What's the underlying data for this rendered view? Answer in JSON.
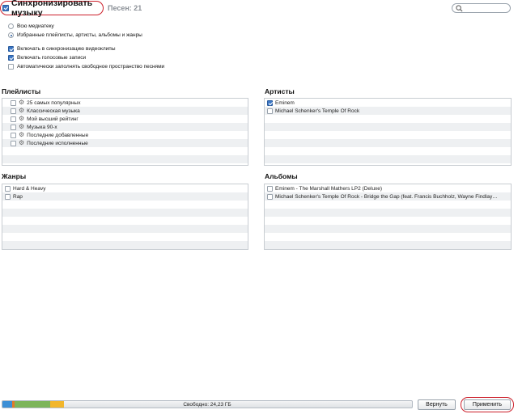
{
  "header": {
    "sync_label": "Синхронизировать музыку",
    "sync_checked": true,
    "song_count": "Песен: 21",
    "search_placeholder": ""
  },
  "options": {
    "radio_all": "Всю медиатеку",
    "radio_selected": "Избранные плейлисты, артисты, альбомы и жанры",
    "include_videos": "Включать в синхронизацию видеоклипы",
    "include_voice": "Включать голосовые записи",
    "autofill": "Автоматически заполнять свободное пространство песнями"
  },
  "playlists": {
    "title": "Плейлисты",
    "items": [
      "25 самых популярных",
      "Классическая музыка",
      "Мой высший рейтинг",
      "Музыка 90-х",
      "Последние добавленные",
      "Последние исполненные"
    ]
  },
  "artists": {
    "title": "Артисты",
    "items": [
      "Eminem",
      "Michael Schenker's Temple Of Rock"
    ],
    "checked": [
      true,
      false
    ]
  },
  "genres": {
    "title": "Жанры",
    "items": [
      "Hard & Heavy",
      "Rap"
    ]
  },
  "albums": {
    "title": "Альбомы",
    "items": [
      "Eminem - The Marshall Mathers LP2 (Deluxe)",
      "Michael Schenker's Temple Of Rock - Bridge the Gap (feat. Francis Buchholz, Wayne Findlay…"
    ]
  },
  "footer": {
    "free_space": "Свободно: 24,23 ГБ",
    "revert_label": "Вернуть",
    "apply_label": "Применить"
  },
  "colors": {
    "accent": "#3b76c4",
    "highlight_ring": "#cc1f2a",
    "capacity_blue": "#3c8fd6",
    "capacity_orange": "#e27a2a",
    "capacity_green": "#7cb55a",
    "capacity_yellow": "#f2b62b"
  }
}
